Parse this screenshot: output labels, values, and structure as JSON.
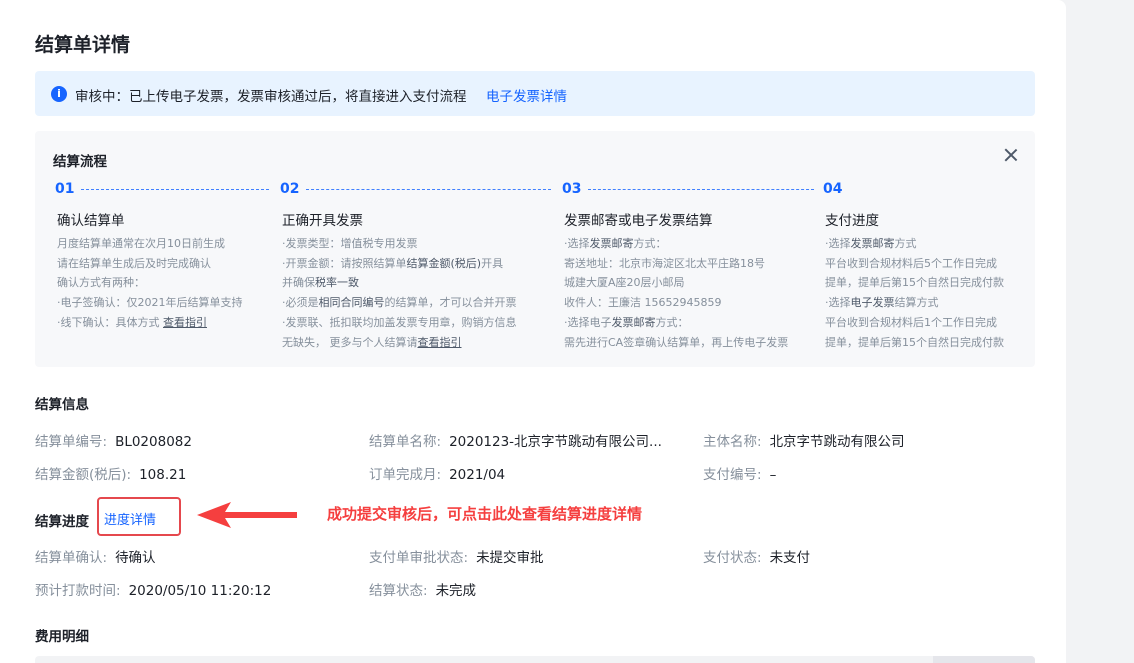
{
  "page": {
    "title": "结算单详情"
  },
  "alert": {
    "text": "审核中：已上传电子发票，发票审核通过后，将直接进入支付流程",
    "link": "电子发票详情"
  },
  "flow": {
    "title": "结算流程",
    "steps": [
      {
        "num": "01",
        "title": "确认结算单",
        "lines": [
          [
            "月度结算单通常在次月10日前生成"
          ],
          [
            "请在结算单生成后及时完成确认"
          ],
          [
            "确认方式有两种："
          ],
          [
            "·电子签确认：仅2021年后结算单支持"
          ],
          [
            "·线下确认：具体方式 ",
            "查看指引"
          ]
        ]
      },
      {
        "num": "02",
        "title": "正确开具发票",
        "lines": [
          [
            "·发票类型：增值税专用发票"
          ],
          [
            "·开票金额：请按照结算单",
            "结算金额(税后)",
            "开具"
          ],
          [
            " 并确保",
            "税率一致"
          ],
          [
            "·必须是",
            "相同合同编号",
            "的结算单，才可以合并开票"
          ],
          [
            "·发票联、抵扣联均加盖发票专用章，购销方信息"
          ],
          [
            " 无缺失， 更多与个人结算请",
            "查看指引"
          ]
        ]
      },
      {
        "num": "03",
        "title": "发票邮寄或电子发票结算",
        "lines": [
          [
            "·选择",
            "发票邮寄",
            "方式："
          ],
          [
            "寄送地址：北京市海淀区北太平庄路18号"
          ],
          [
            "城建大厦A座20层小邮局"
          ],
          [
            "收件人：王廉洁 15652945859"
          ],
          [
            "·选择电子",
            "发票邮寄",
            "方式："
          ],
          [
            "需先进行CA签章确认结算单，再上传电子发票"
          ]
        ]
      },
      {
        "num": "04",
        "title": "支付进度",
        "lines": [
          [
            "·选择",
            "发票邮寄",
            "方式"
          ],
          [
            "平台收到合规材料后5个工作日完成"
          ],
          [
            "提单，提单后第15个自然日完成付款"
          ],
          [
            "·选择",
            "电子发票",
            "结算方式"
          ],
          [
            "平台收到合规材料后1个工作日完成"
          ],
          [
            "提单，提单后第15个自然日完成付款"
          ]
        ]
      }
    ]
  },
  "settlement_info": {
    "title": "结算信息",
    "fields": {
      "bill_no_label": "结算单编号:",
      "bill_no": "BL0208082",
      "bill_name_label": "结算单名称:",
      "bill_name": "2020123-北京字节跳动有限公司...",
      "entity_label": "主体名称:",
      "entity": "北京字节跳动有限公司",
      "amount_label": "结算金额(税后):",
      "amount": "108.21",
      "order_month_label": "订单完成月:",
      "order_month": "2021/04",
      "pay_no_label": "支付编号:",
      "pay_no": "–"
    }
  },
  "progress": {
    "title": "结算进度",
    "link": "进度详情",
    "fields": {
      "confirm_label": "结算单确认:",
      "confirm": "待确认",
      "approval_label": "支付单审批状态:",
      "approval": "未提交审批",
      "pay_status_label": "支付状态:",
      "pay_status": "未支付",
      "eta_label": "预计打款时间:",
      "eta": "2020/05/10 11:20:12",
      "status_label": "结算状态:",
      "status": "未完成"
    }
  },
  "annotation": {
    "text": "成功提交审核后，可点击此处查看结算进度详情",
    "color": "#f53f3f"
  },
  "fee": {
    "title": "费用明细"
  },
  "colors": {
    "primary": "#1664ff",
    "alert_bg": "#e8f3ff",
    "panel_bg": "#f7f8fa"
  }
}
